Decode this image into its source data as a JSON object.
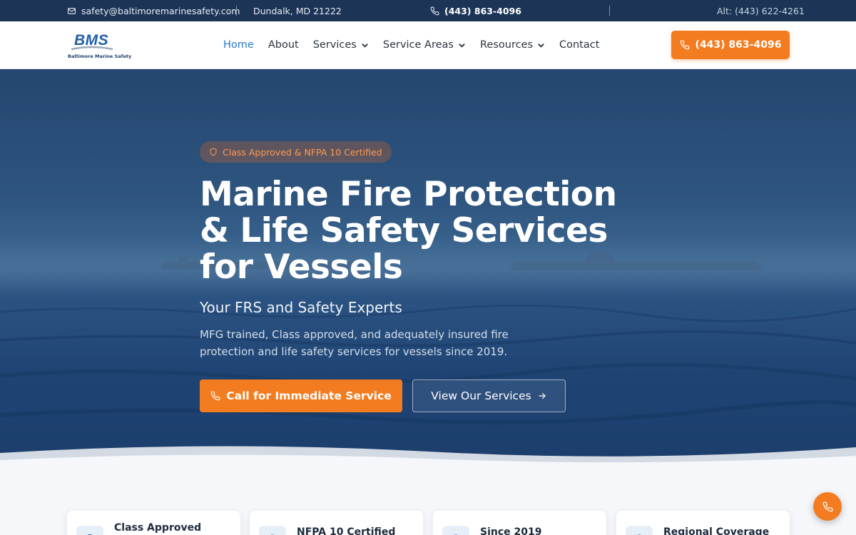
{
  "topbar": {
    "email": "safety@baltimoremarinesafety.com",
    "location": "Dundalk, MD 21222",
    "phone": "(443) 863-4096",
    "alt_phone": "Alt: (443) 622-4261"
  },
  "header": {
    "logo_text": "BMS",
    "logo_tagline": "Baltimore Marine Safety",
    "nav": [
      {
        "label": "Home"
      },
      {
        "label": "About"
      },
      {
        "label": "Services"
      },
      {
        "label": "Service Areas"
      },
      {
        "label": "Resources"
      },
      {
        "label": "Contact"
      }
    ],
    "cta_label": "(443) 863-4096"
  },
  "hero": {
    "badge": "Class Approved & NFPA 10 Certified",
    "headline": "Marine Fire Protection & Life Safety Services for Vessels",
    "subhead": "Your FRS and Safety Experts",
    "description": "MFG trained, Class approved, and adequately insured fire protection and life safety services for vessels since 2019.",
    "primary_button": "Call for Immediate Service",
    "secondary_button": "View Our Services"
  },
  "features": [
    {
      "title": "Class Approved"
    },
    {
      "title": "NFPA 10 Certified"
    },
    {
      "title": "Since 2019"
    },
    {
      "title": "Regional Coverage"
    }
  ],
  "colors": {
    "accent": "#f47c20",
    "topbar": "#1c3557",
    "nav_active": "#2a78c8"
  }
}
